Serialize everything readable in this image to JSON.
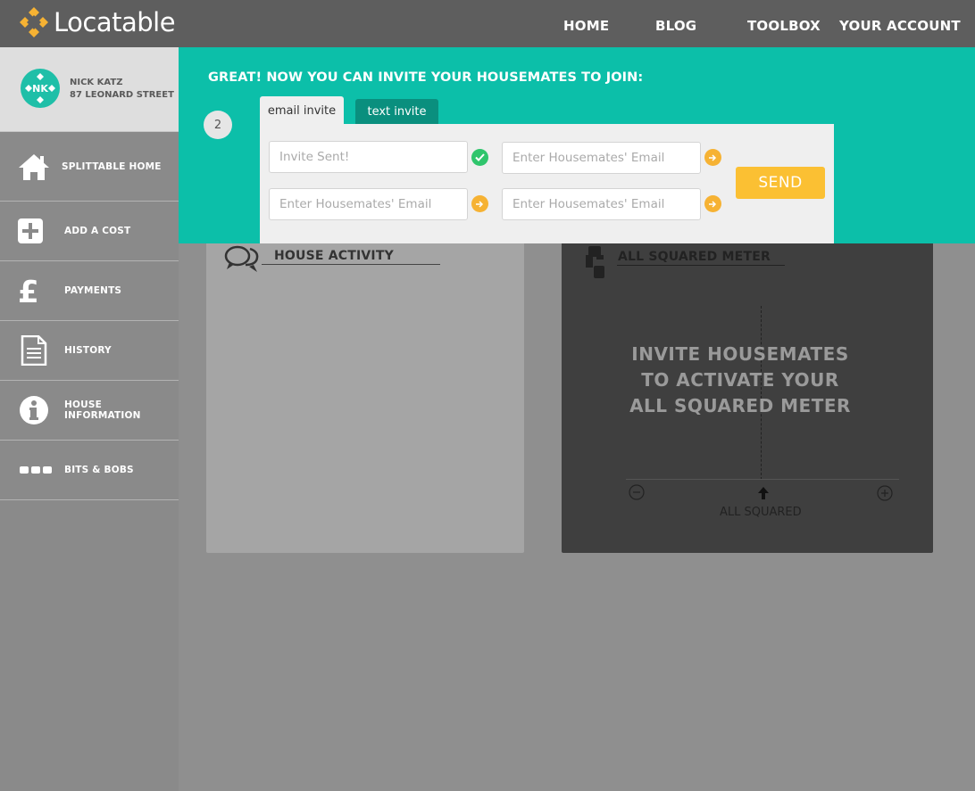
{
  "brand": {
    "name": "Locatable",
    "accent": "#0cbfa9"
  },
  "nav": {
    "home": "HOME",
    "blog": "BLOG",
    "toolbox": "TOOLBOX",
    "account": "YOUR ACCOUNT"
  },
  "profile": {
    "initials": "NK",
    "name": "NICK KATZ",
    "address": "87 LEONARD STREET"
  },
  "sidebar": {
    "items": [
      {
        "label": "SPLITTABLE HOME",
        "icon": "home-icon"
      },
      {
        "label": "ADD A COST",
        "icon": "plus-icon"
      },
      {
        "label": "PAYMENTS",
        "icon": "pound-icon"
      },
      {
        "label": "HISTORY",
        "icon": "document-icon"
      },
      {
        "label": "HOUSE INFORMATION",
        "icon": "info-icon"
      },
      {
        "label": "BITS & BOBS",
        "icon": "dots-icon"
      }
    ]
  },
  "invite": {
    "title": "GREAT! NOW YOU CAN INVITE YOUR HOUSEMATES TO JOIN:",
    "step": "2",
    "tabs": {
      "email": "email invite",
      "text": "text invite"
    },
    "fields": [
      {
        "placeholder": "Invite Sent!",
        "status": "sent"
      },
      {
        "placeholder": "Enter Housemates' Email",
        "status": "pending"
      },
      {
        "placeholder": "Enter Housemates' Email",
        "status": "pending"
      },
      {
        "placeholder": "Enter Housemates' Email",
        "status": "pending"
      }
    ],
    "send_label": "SEND"
  },
  "activity": {
    "title": "HOUSE ACTIVITY"
  },
  "meter": {
    "title": "ALL SQUARED METER",
    "line1": "INVITE HOUSEMATES",
    "line2": "TO ACTIVATE YOUR",
    "line3": "ALL SQUARED METER",
    "center_label": "ALL SQUARED"
  }
}
